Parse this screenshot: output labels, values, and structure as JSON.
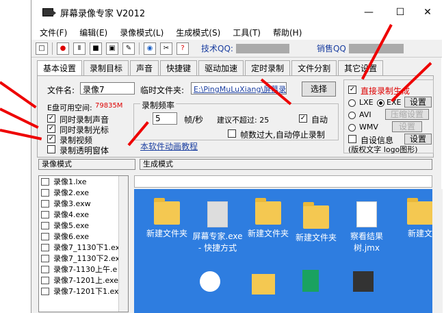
{
  "window": {
    "title": "屏幕录像专家 V2012",
    "min": "—",
    "max": "☐",
    "close": "✕"
  },
  "menu": [
    "文件(F)",
    "编辑(E)",
    "录像模式(L)",
    "生成模式(S)",
    "工具(T)",
    "帮助(H)"
  ],
  "toolbar": {
    "tech_qq": "技术QQ:",
    "sales_qq": "销售QQ"
  },
  "tabs": [
    "基本设置",
    "录制目标",
    "声音",
    "快捷键",
    "驱动加速",
    "定时录制",
    "文件分割",
    "其它设置"
  ],
  "basic": {
    "filename_label": "文件名:",
    "filename_value": "录像7",
    "tempdir_label": "临时文件夹:",
    "tempdir_value": "E:\\PingMuLuXiang\\屏幕录",
    "choose_button": "选择",
    "disk_space_label": "E盘可用空间:",
    "disk_space_value": "79835M",
    "rec_audio": "同时录制声音",
    "rec_cursor": "同时录制光标",
    "rec_video": "录制视频",
    "rec_transparent": "录制透明窗体",
    "frame_rate_group": "录制频率",
    "fps_value": "5",
    "fps_unit": "帧/秒",
    "suggest_label": "建议不超过: 25",
    "auto_label": "自动",
    "auto_stop_label": "帧数过大,自动停止录制",
    "tutorial_link": "本软件动画教程"
  },
  "gen": {
    "direct_gen": "直接录制生成",
    "lxe": "LXE",
    "exe": "EXE",
    "avi": "AVI",
    "wmv": "WMV",
    "settings1": "设置",
    "compress": "压缩设置",
    "settings2": "设置",
    "auto_info": "自设信息",
    "settings3": "设置",
    "caption": "(版权文字 logo图形)"
  },
  "sections": {
    "record_mode": "录像模式",
    "gen_mode": "生成模式"
  },
  "files": [
    "录像1.lxe",
    "录像2.exe",
    "录像3.exw",
    "录像4.exe",
    "录像5.exe",
    "录像6.exe",
    "录像7_1130下1.ex",
    "录像7_1130下2.ex",
    "录像7-1130上午.e",
    "录像7-1201上.exe",
    "录像7-1201下1.ex"
  ],
  "desktop": [
    "新建文件夹",
    "屏幕专家.exe - 快捷方式",
    "新建文件夹",
    "新建文件夹",
    "察看结果树.jmx",
    "新建文"
  ]
}
